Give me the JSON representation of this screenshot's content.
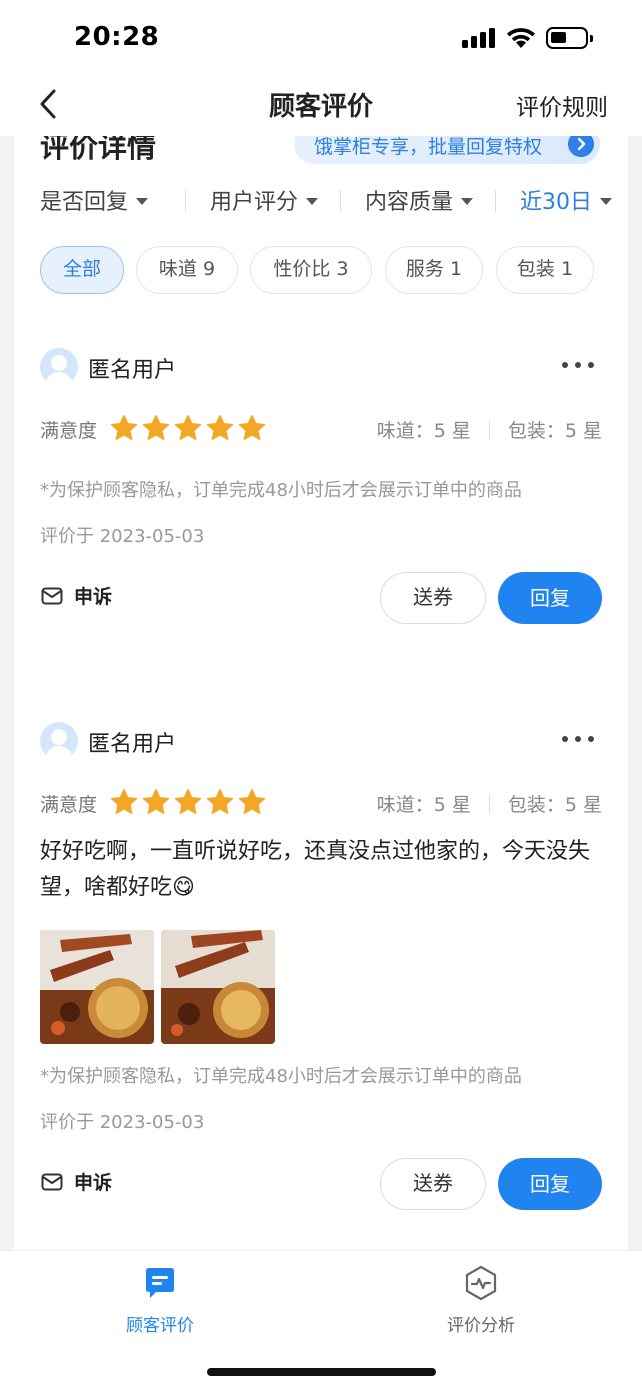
{
  "status_bar": {
    "time": "20:28"
  },
  "navbar": {
    "title": "顾客评价",
    "rule_link": "评价规则"
  },
  "section": {
    "title": "评价详情",
    "promo": "饿掌柜专享，批量回复特权"
  },
  "filters": [
    {
      "label": "是否回复"
    },
    {
      "label": "用户评分"
    },
    {
      "label": "内容质量"
    },
    {
      "label": "近30日"
    }
  ],
  "chips": [
    {
      "label": "全部"
    },
    {
      "label": "味道 9"
    },
    {
      "label": "性价比 3"
    },
    {
      "label": "服务 1"
    },
    {
      "label": "包装 1"
    }
  ],
  "reviews": [
    {
      "user": "匿名用户",
      "satisfaction_label": "满意度",
      "stars": 5,
      "taste": "味道：5 星",
      "packaging": "包装：5 星",
      "privacy_note": "*为保护顾客隐私，订单完成48小时后才会展示订单中的商品",
      "date": "评价于 2023-05-03",
      "appeal": "申诉",
      "coupon_button": "送券",
      "reply_button": "回复"
    },
    {
      "user": "匿名用户",
      "satisfaction_label": "满意度",
      "stars": 5,
      "taste": "味道：5 星",
      "packaging": "包装：5 星",
      "comment": "好好吃啊，一直听说好吃，还真没点过他家的，今天没失望，啥都好吃😋",
      "photo_count": 2,
      "privacy_note": "*为保护顾客隐私，订单完成48小时后才会展示订单中的商品",
      "date": "评价于 2023-05-03",
      "appeal": "申诉",
      "coupon_button": "送券",
      "reply_button": "回复"
    }
  ],
  "tabbar": [
    {
      "label": "顾客评价"
    },
    {
      "label": "评价分析"
    }
  ],
  "colors": {
    "accent": "#1f84f0",
    "star": "#f5a623",
    "active_tab": "#1f84f0",
    "inactive_tab": "#666666"
  }
}
